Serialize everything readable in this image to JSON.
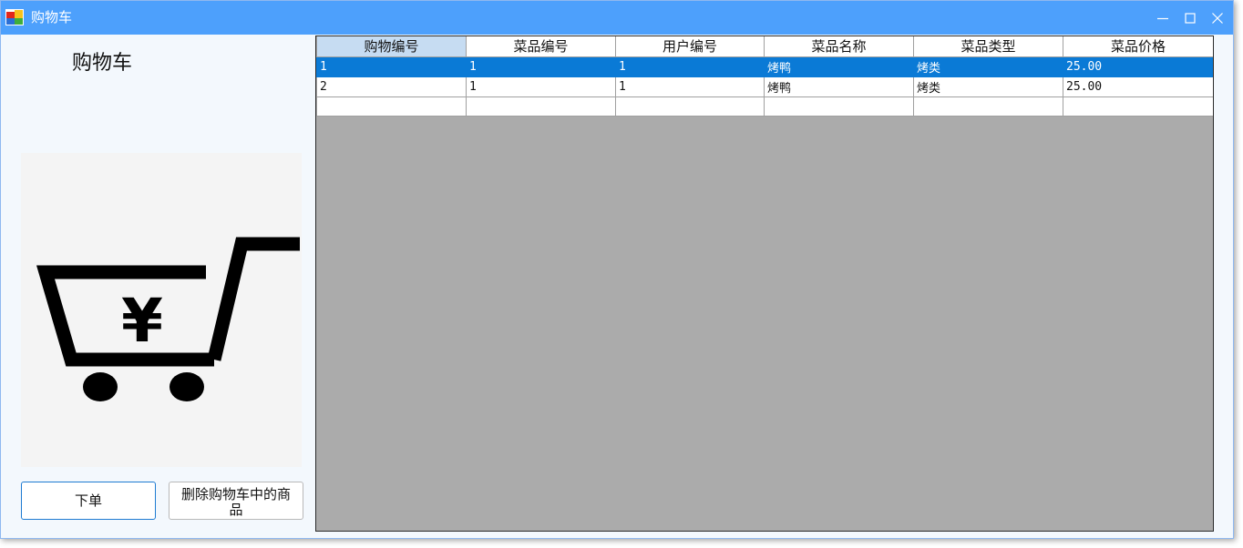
{
  "window": {
    "title": "购物车"
  },
  "sidebar": {
    "heading": "购物车",
    "cart_image_icon": "cart-yen-icon",
    "order_button": "下单",
    "delete_button": "删除购物车中的商品"
  },
  "grid": {
    "columns": [
      "购物编号",
      "菜品编号",
      "用户编号",
      "菜品名称",
      "菜品类型",
      "菜品价格"
    ],
    "rows": [
      [
        "1",
        "1",
        "1",
        "烤鸭",
        "烤类",
        "25.00"
      ],
      [
        "2",
        "1",
        "1",
        "烤鸭",
        "烤类",
        "25.00"
      ]
    ],
    "selected_row_index": 0
  },
  "colors": {
    "titlebar": "#4da0fc",
    "selection": "#0a7ad6",
    "grid_background": "#ababab",
    "header_selected": "#c6dcf2"
  }
}
